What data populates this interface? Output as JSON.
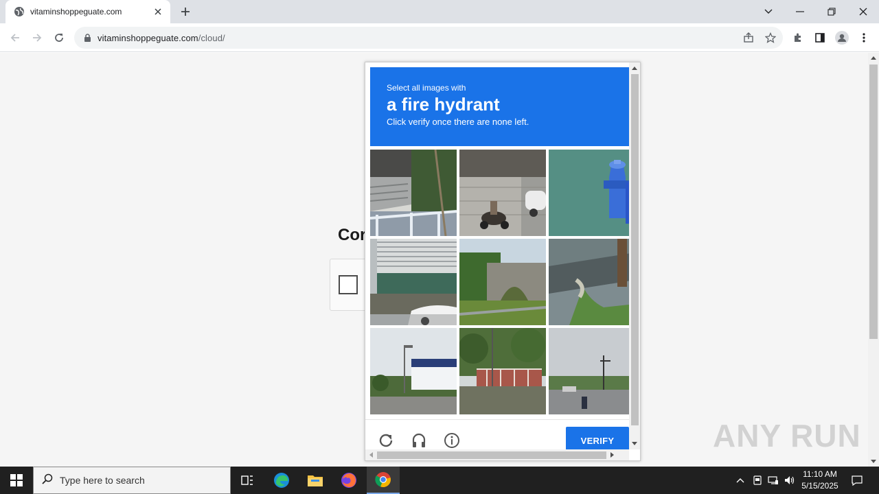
{
  "browser": {
    "tab_title": "vitaminshoppeguate.com",
    "url_host": "vitaminshoppeguate.com",
    "url_path": "/cloud/",
    "icons": [
      "globe-icon",
      "close-icon",
      "plus-icon",
      "chevron-down-icon",
      "minimize-icon",
      "restore-icon",
      "back-icon",
      "forward-icon",
      "reload-icon",
      "lock-icon",
      "share-icon",
      "star-icon",
      "extensions-icon",
      "side-panel-icon",
      "profile-icon",
      "menu-icon"
    ]
  },
  "page": {
    "heading_partial": "Cor"
  },
  "captcha": {
    "prompt_small": "Select all images with",
    "prompt_target": "a fire hydrant",
    "prompt_sub": "Click verify once there are none left.",
    "verify_label": "VERIFY",
    "header_color": "#1a73e8",
    "tiles": [
      "stairs-railing",
      "scooter-building",
      "fire-hydrant",
      "building-car",
      "stone-bridge",
      "curb-grass",
      "street-building",
      "fence-trees",
      "road-intersection"
    ]
  },
  "watermark": "ANY RUN",
  "taskbar": {
    "search_placeholder": "Type here to search",
    "time": "11:10 AM",
    "date": "5/15/2025"
  }
}
